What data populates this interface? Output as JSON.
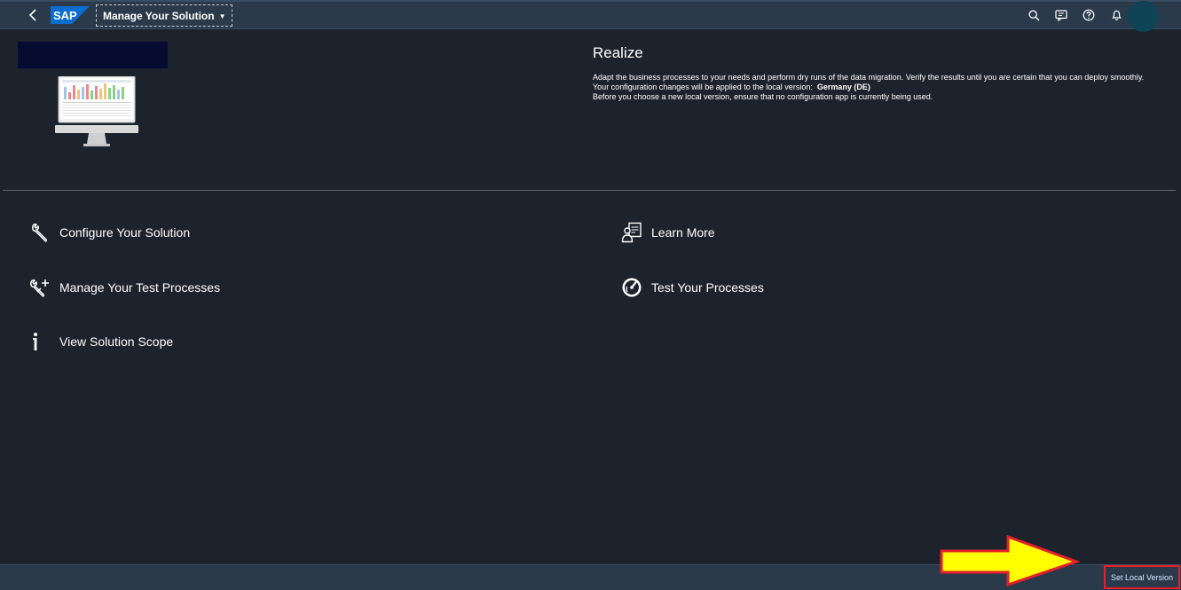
{
  "shellbar": {
    "app_title": "Manage Your Solution",
    "logo_text": "SAP",
    "icons": [
      "back-icon",
      "search-icon",
      "feedback-icon",
      "help-icon",
      "notification-icon"
    ],
    "colors": {
      "bar": "#2b3a4a",
      "logo": "#0a6ed1",
      "avatar": "#0e4455"
    }
  },
  "header": {
    "title": "Realize",
    "description": "Adapt the business processes to your needs and perform dry runs of the data migration. Verify the results until you are certain that you can deploy smoothly.",
    "local_version_prefix": "Your configuration changes will be applied to the local version:",
    "local_version_value": "Germany (DE)",
    "note": "Before you choose a new local version, ensure that no configuration app is currently being used."
  },
  "links": {
    "configure": "Configure Your Solution",
    "manage_tests": "Manage Your Test Processes",
    "view_scope": "View Solution Scope",
    "learn_more": "Learn More",
    "test_processes": "Test Your Processes"
  },
  "footer": {
    "set_local_version": "Set Local Version",
    "highlight_color": "#e5202a",
    "arrow_color": "#ffff00"
  }
}
